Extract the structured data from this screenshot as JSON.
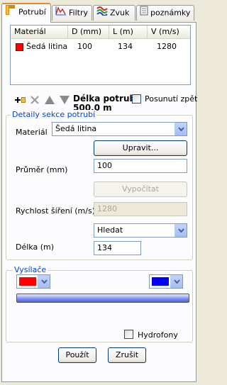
{
  "tabs": [
    {
      "label": "Potrubí",
      "icon": "pipe-icon",
      "active": true
    },
    {
      "label": "Filtry",
      "icon": "filter-chart-icon",
      "active": false
    },
    {
      "label": "Zvuk",
      "icon": "sound-wave-icon",
      "active": false
    },
    {
      "label": "poznámky",
      "icon": "notes-icon",
      "active": false
    }
  ],
  "section_list": {
    "columns": [
      "Materiál",
      "D (mm)",
      "L (m)",
      "V (m/s)"
    ],
    "rows": [
      {
        "material": "Šedá litina",
        "color": "#ff0000",
        "d": "100",
        "l": "134",
        "v": "1280"
      }
    ]
  },
  "toolbar": {
    "length_label": "Délka potrubí:",
    "length_value": "500,0 m",
    "shift_back_label": "Posunutí zpět"
  },
  "details": {
    "legend": "Detaily sekce potrubí",
    "material_label": "Materiál",
    "material_value": "Šedá litina",
    "edit_button": "Upravit...",
    "diameter_label": "Průměr (mm)",
    "diameter_value": "100",
    "compute_button": "Vypočítat",
    "speed_label": "Rychlost šíření (m/s)",
    "speed_value": "1280",
    "search_value": "Hledat",
    "length_label": "Délka (m)",
    "length_value": "134"
  },
  "transmitters": {
    "legend": "Vysílače",
    "left_color": "#ff0000",
    "right_color": "#0000ff",
    "hydrophones_label": "Hydrofony"
  },
  "buttons": {
    "apply": "Použít",
    "cancel": "Zrušit"
  }
}
